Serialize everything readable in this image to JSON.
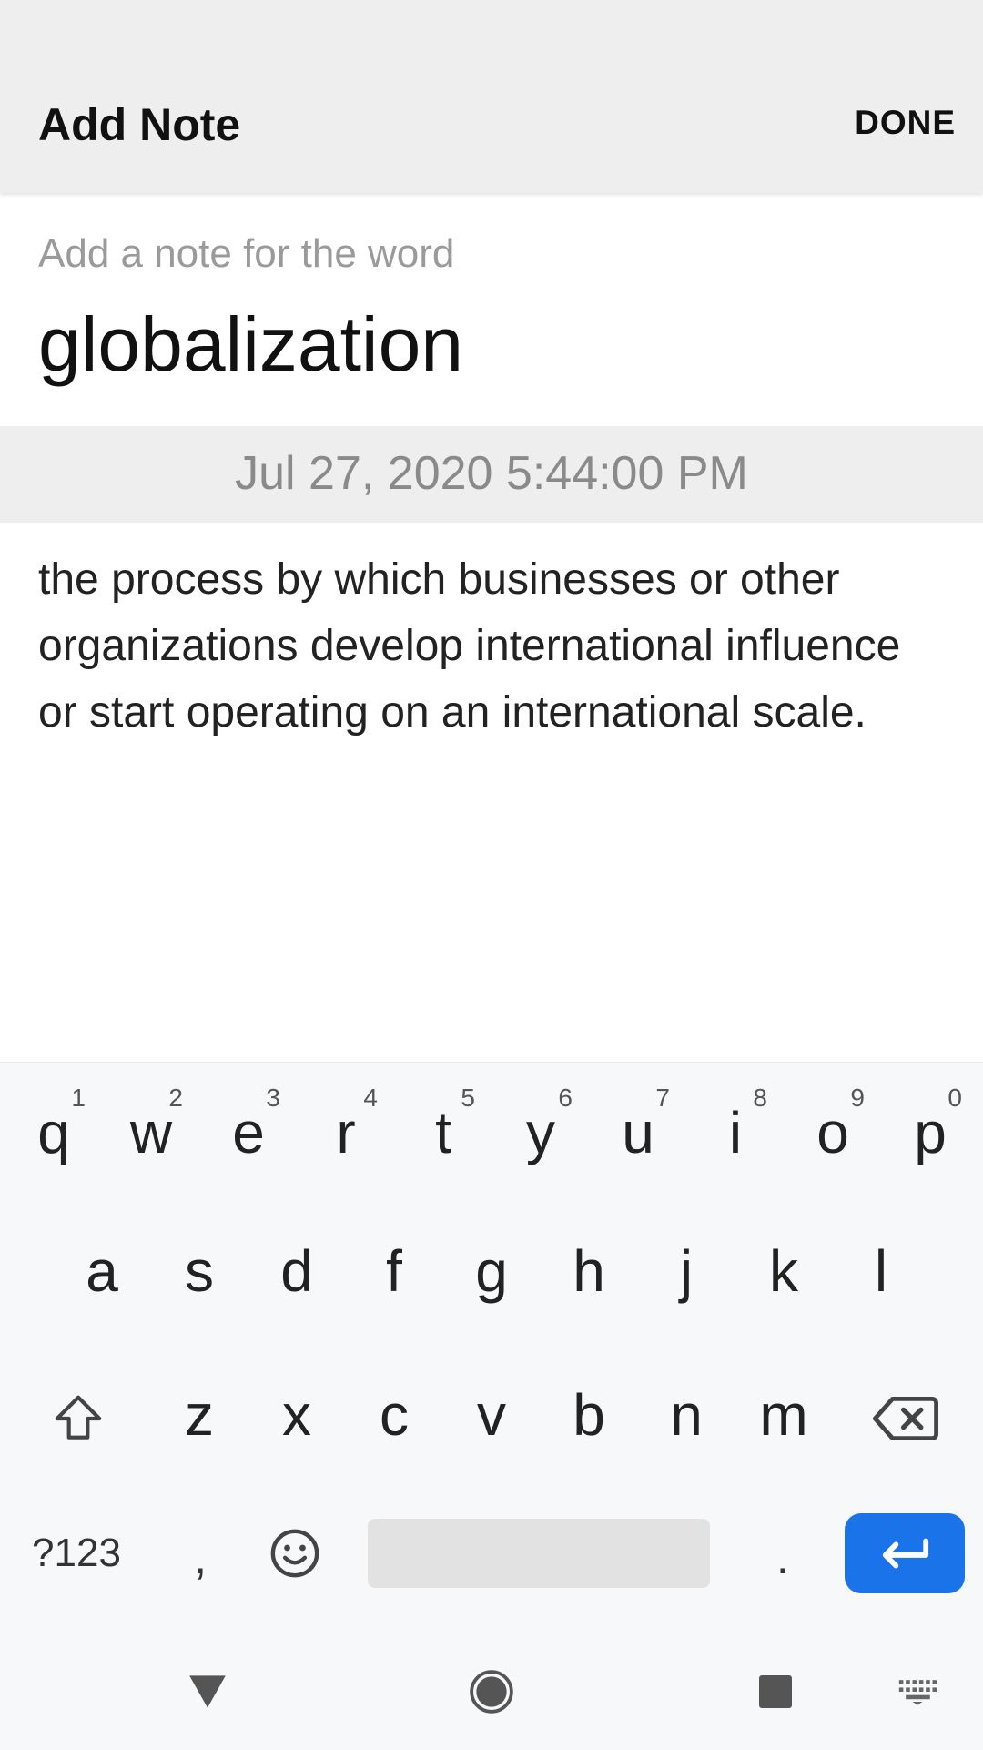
{
  "appbar": {
    "title": "Add Note",
    "done_label": "DONE"
  },
  "note": {
    "hint": "Add a note for the word",
    "word": "globalization",
    "date": "Jul 27, 2020 5:44:00 PM",
    "text": "the process by which businesses or other organizations develop international influence or start operating on an international scale."
  },
  "keyboard": {
    "row1": [
      {
        "key": "q",
        "sup": "1"
      },
      {
        "key": "w",
        "sup": "2"
      },
      {
        "key": "e",
        "sup": "3"
      },
      {
        "key": "r",
        "sup": "4"
      },
      {
        "key": "t",
        "sup": "5"
      },
      {
        "key": "y",
        "sup": "6"
      },
      {
        "key": "u",
        "sup": "7"
      },
      {
        "key": "i",
        "sup": "8"
      },
      {
        "key": "o",
        "sup": "9"
      },
      {
        "key": "p",
        "sup": "0"
      }
    ],
    "row2": [
      "a",
      "s",
      "d",
      "f",
      "g",
      "h",
      "j",
      "k",
      "l"
    ],
    "row3": [
      "z",
      "x",
      "c",
      "v",
      "b",
      "n",
      "m"
    ],
    "symbols_label": "?123",
    "comma_label": ",",
    "period_label": ".",
    "enter_color": "#1a73e8"
  },
  "icons": {
    "shift": "shift-icon",
    "backspace": "backspace-icon",
    "emoji": "emoji-icon",
    "enter": "enter-icon",
    "back": "back-triangle-icon",
    "home": "home-circle-icon",
    "recents": "recents-square-icon",
    "keyboard_switch": "keyboard-icon"
  }
}
